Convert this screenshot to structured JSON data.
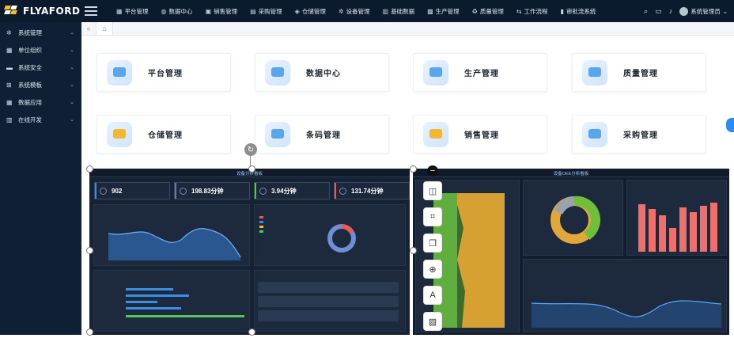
{
  "brand": {
    "name": "FLYAFORD"
  },
  "topnav": [
    {
      "label": "平台管理",
      "icon": "grid-icon"
    },
    {
      "label": "数据中心",
      "icon": "globe-icon"
    },
    {
      "label": "销售管理",
      "icon": "bag-icon"
    },
    {
      "label": "采购管理",
      "icon": "cart-icon"
    },
    {
      "label": "仓储管理",
      "icon": "warehouse-icon"
    },
    {
      "label": "设备管理",
      "icon": "gear-icon"
    },
    {
      "label": "基础数据",
      "icon": "database-icon"
    },
    {
      "label": "生产管理",
      "icon": "factory-icon"
    },
    {
      "label": "质量管理",
      "icon": "recycle-icon"
    },
    {
      "label": "工作流程",
      "icon": "flow-icon"
    },
    {
      "label": "审批流系统",
      "icon": "approval-icon"
    }
  ],
  "user": {
    "name": "系统管理员"
  },
  "sidebar": [
    {
      "label": "系统管理",
      "icon": "gear-icon"
    },
    {
      "label": "单位组织",
      "icon": "org-icon"
    },
    {
      "label": "系统安全",
      "icon": "shield-icon"
    },
    {
      "label": "系统模板",
      "icon": "template-icon"
    },
    {
      "label": "数据应用",
      "icon": "grid-icon"
    },
    {
      "label": "在线开发",
      "icon": "code-icon"
    }
  ],
  "cards": [
    {
      "label": "平台管理",
      "accent": "#5aa6ee"
    },
    {
      "label": "数据中心",
      "accent": "#5aa6ee"
    },
    {
      "label": "生产管理",
      "accent": "#5aa6ee"
    },
    {
      "label": "质量管理",
      "accent": "#5aa6ee"
    },
    {
      "label": "仓储管理",
      "accent": "#f3b731"
    },
    {
      "label": "条码管理",
      "accent": "#5aa6ee"
    },
    {
      "label": "销售管理",
      "accent": "#f3b731"
    },
    {
      "label": "采购管理",
      "accent": "#5aa6ee"
    }
  ],
  "dashboard_a": {
    "title": "设备分析看板",
    "kpis": [
      {
        "value": "902",
        "color": "#3a8ee6"
      },
      {
        "value": "198.83分钟",
        "color": "#6a7da0"
      },
      {
        "value": "3.94分钟",
        "color": "#57c35a"
      },
      {
        "value": "131.74分钟",
        "color": "#e45b5b"
      }
    ]
  },
  "dashboard_b": {
    "title": "设备OEE分析看板"
  },
  "colors": {
    "topbar": "#0c1a2e",
    "sidebar": "#0e1f36",
    "accent": "#2d8cf0"
  }
}
